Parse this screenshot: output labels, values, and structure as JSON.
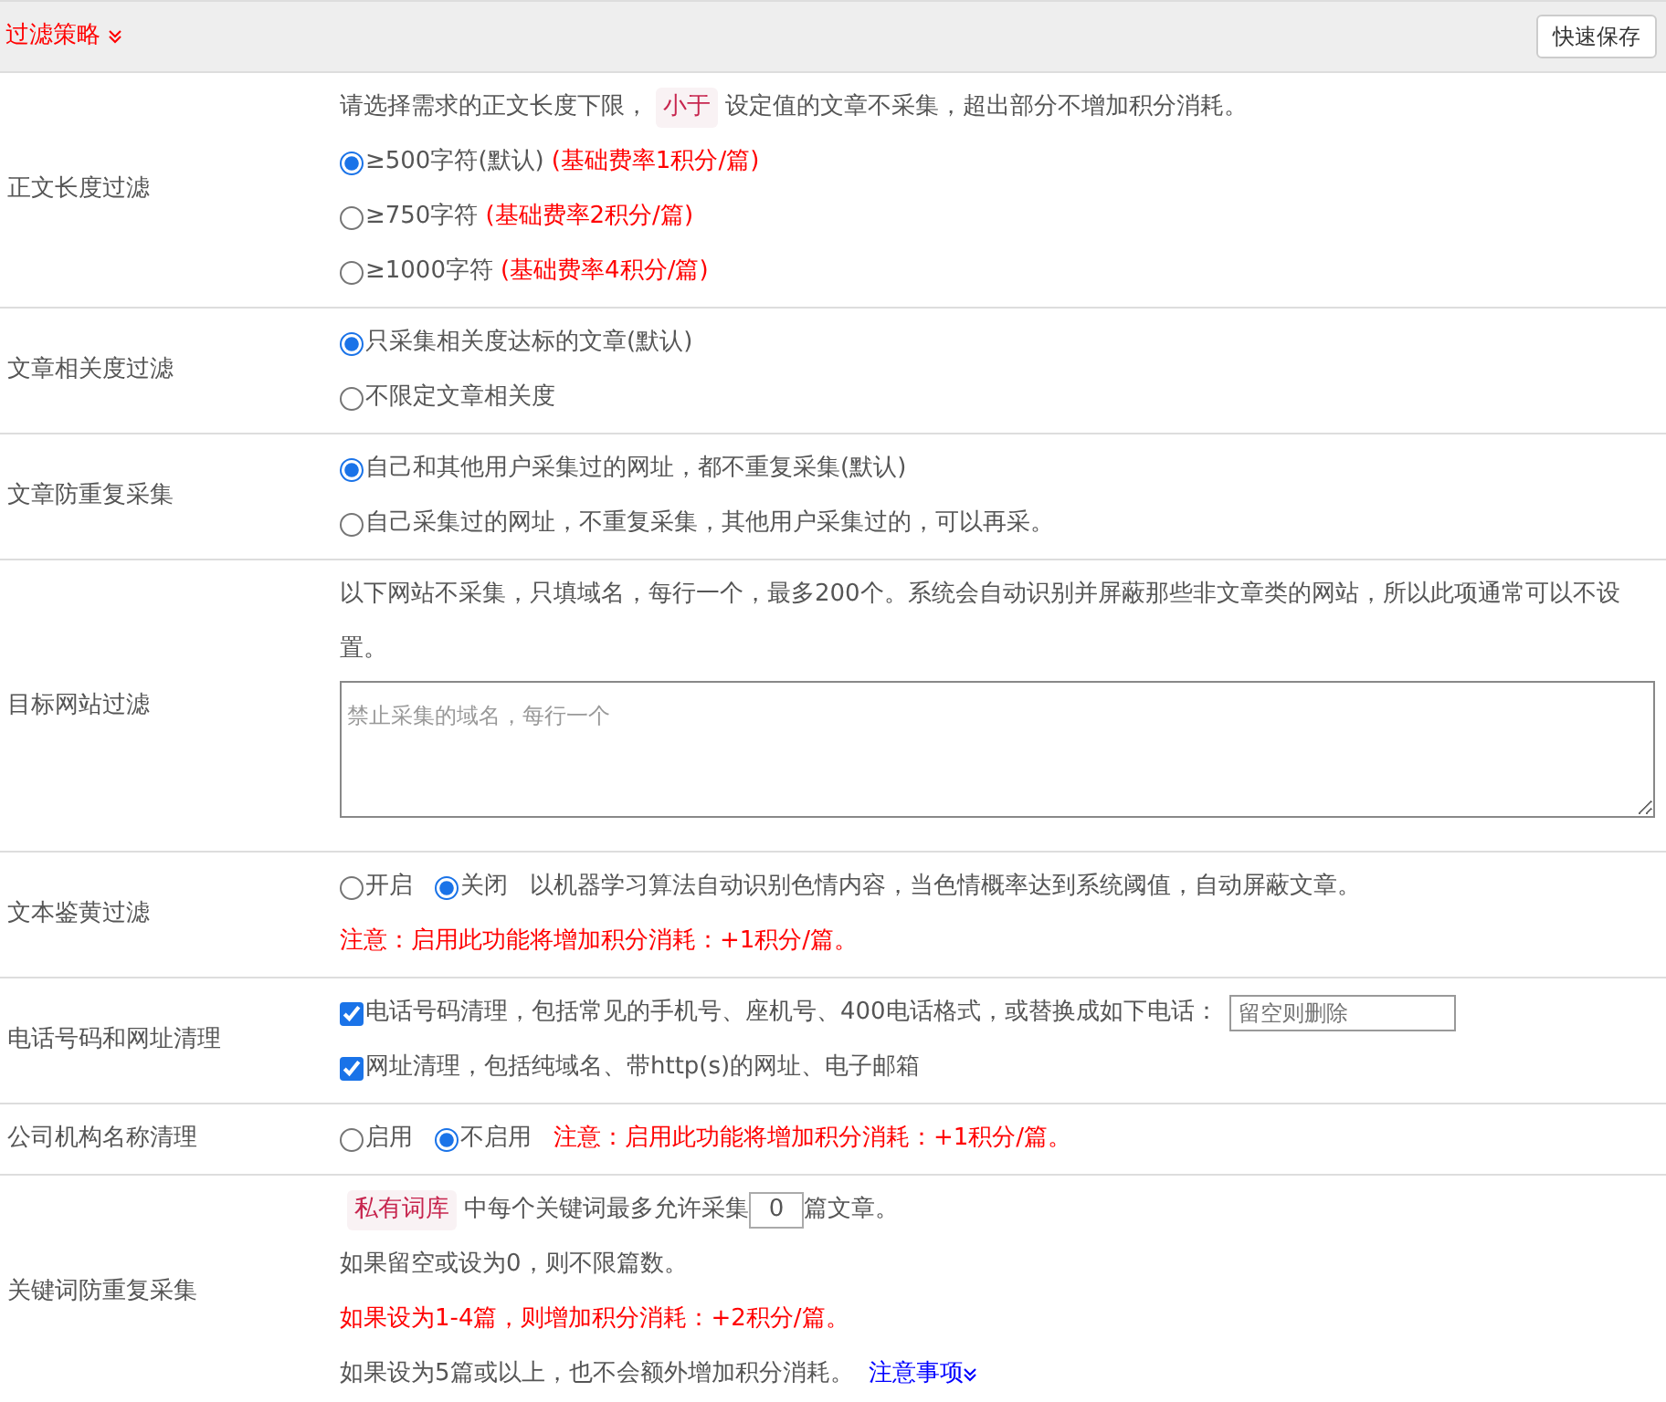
{
  "header": {
    "title": "过滤策略",
    "save_button": "快速保存"
  },
  "rows": [
    {
      "label": "正文长度过滤",
      "lines": [
        {
          "kind": "text",
          "parts": [
            {
              "kind": "plain",
              "text": "请选择需求的正文长度下限，"
            },
            {
              "kind": "tag",
              "text": "小于"
            },
            {
              "kind": "plain",
              "text": "设定值的文章不采集，超出部分不增加积分消耗。"
            }
          ]
        },
        {
          "kind": "radio",
          "selected": true,
          "text": "≥500字符(默认)",
          "note": "(基础费率1积分/篇)"
        },
        {
          "kind": "radio",
          "selected": false,
          "text": "≥750字符",
          "note": "(基础费率2积分/篇)"
        },
        {
          "kind": "radio",
          "selected": false,
          "text": "≥1000字符",
          "note": "(基础费率4积分/篇)"
        }
      ]
    },
    {
      "label": "文章相关度过滤",
      "lines": [
        {
          "kind": "radio",
          "selected": true,
          "text": "只采集相关度达标的文章(默认)"
        },
        {
          "kind": "radio",
          "selected": false,
          "text": "不限定文章相关度"
        }
      ]
    },
    {
      "label": "文章防重复采集",
      "lines": [
        {
          "kind": "radio",
          "selected": true,
          "text": "自己和其他用户采集过的网址，都不重复采集(默认)"
        },
        {
          "kind": "radio",
          "selected": false,
          "text": "自己采集过的网址，不重复采集，其他用户采集过的，可以再采。"
        }
      ]
    },
    {
      "label": "目标网站过滤",
      "lines": [
        {
          "kind": "text",
          "parts": [
            {
              "kind": "plain",
              "text": "以下网站不采集，只填域名，每行一个，最多200个。系统会自动识别并屏蔽那些非文章类的网站，所以此项通常可以不设置。"
            }
          ]
        },
        {
          "kind": "textarea",
          "placeholder": "禁止采集的域名，每行一个"
        }
      ]
    },
    {
      "label": "文本鉴黄过滤",
      "lines": [
        {
          "kind": "choices",
          "options": [
            {
              "text": "开启",
              "selected": false
            },
            {
              "text": "关闭",
              "selected": true
            }
          ],
          "note": "以机器学习算法自动识别色情内容，当色情概率达到系统阈值，自动屏蔽文章。"
        },
        {
          "kind": "text",
          "parts": [
            {
              "kind": "red",
              "text": "注意：启用此功能将增加积分消耗：+1积分/篇。"
            }
          ]
        }
      ]
    },
    {
      "label": "电话号码和网址清理",
      "lines": [
        {
          "kind": "checkbox",
          "checked": true,
          "text": "电话号码清理，包括常见的手机号、座机号、400电话格式，或替换成如下电话：",
          "placeholder": "留空则删除"
        },
        {
          "kind": "checkbox",
          "checked": true,
          "text": "网址清理，包括纯域名、带http(s)的网址、电子邮箱"
        }
      ]
    },
    {
      "label": "公司机构名称清理",
      "lines": [
        {
          "kind": "choices",
          "options": [
            {
              "text": "启用",
              "selected": false
            },
            {
              "text": "不启用",
              "selected": true
            }
          ],
          "warning": "注意：启用此功能将增加积分消耗：+1积分/篇。"
        }
      ]
    },
    {
      "label": "关键词防重复采集",
      "lines": [
        {
          "kind": "text",
          "parts": [
            {
              "kind": "tag",
              "text": "私有词库"
            },
            {
              "kind": "plain",
              "text": "中每个关键词最多允许采集"
            },
            {
              "kind": "input",
              "text": "0"
            },
            {
              "kind": "plain",
              "text": "篇文章。"
            }
          ]
        },
        {
          "kind": "text",
          "parts": [
            {
              "kind": "plain",
              "text": "如果留空或设为0，则不限篇数。"
            }
          ]
        },
        {
          "kind": "text",
          "parts": [
            {
              "kind": "red",
              "text": "如果设为1-4篇，则增加积分消耗：+2积分/篇。"
            }
          ]
        },
        {
          "kind": "text",
          "parts": [
            {
              "kind": "plain",
              "text": "如果设为5篇或以上，也不会额外增加积分消耗。"
            },
            {
              "kind": "link",
              "text": "注意事项"
            }
          ]
        }
      ]
    }
  ]
}
